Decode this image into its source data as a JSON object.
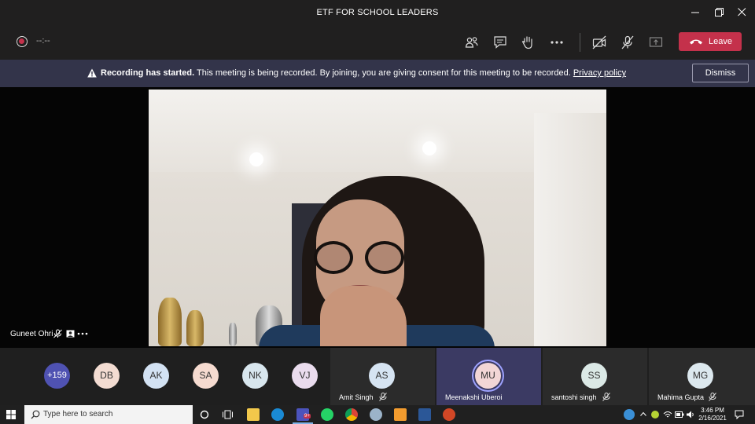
{
  "window": {
    "title": "ETF FOR SCHOOL LEADERS"
  },
  "toolbar": {
    "timer": "--:--",
    "leave_label": "Leave",
    "icons": [
      "participants-icon",
      "chat-icon",
      "raise-hand-icon",
      "more-icon",
      "camera-off-icon",
      "mic-off-icon",
      "share-icon"
    ]
  },
  "banner": {
    "bold": "Recording has started.",
    "text": " This meeting is being recorded. By joining, you are giving consent for this meeting to be recorded. ",
    "link": "Privacy policy",
    "dismiss_label": "Dismiss"
  },
  "stage": {
    "speaker_name": "Guneet Ohri"
  },
  "participants": {
    "overflow": "+159",
    "avatars": [
      {
        "initials": "DB",
        "color": "#f3dcd2"
      },
      {
        "initials": "AK",
        "color": "#d3e2f3"
      },
      {
        "initials": "SA",
        "color": "#f6dbd0"
      },
      {
        "initials": "NK",
        "color": "#d8e6ee"
      },
      {
        "initials": "VJ",
        "color": "#eadcee"
      }
    ],
    "tiles": [
      {
        "initials": "AS",
        "name": "Amit Singh",
        "color": "#d6e4f2"
      },
      {
        "initials": "MU",
        "name": "Meenakshi Uberoi",
        "color": "#f2d6d6"
      },
      {
        "initials": "SS",
        "name": "santoshi singh",
        "color": "#dbe9e6"
      },
      {
        "initials": "MG",
        "name": "Mahima Gupta",
        "color": "#dce8ee"
      }
    ]
  },
  "taskbar": {
    "search_placeholder": "Type here to search",
    "badge": "9+",
    "time": "3:46 PM",
    "date": "2/16/2021"
  },
  "colors": {
    "accent": "#6264a7",
    "leave": "#c4314b",
    "banner": "#33344a"
  }
}
